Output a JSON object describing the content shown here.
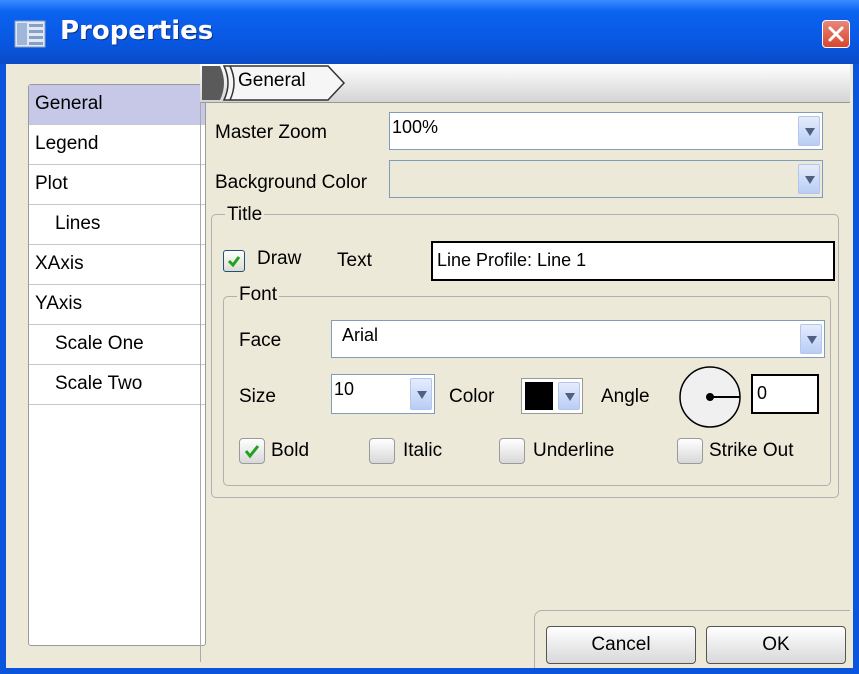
{
  "window": {
    "title": "Properties"
  },
  "sidebar": {
    "items": [
      {
        "label": "General",
        "selected": true
      },
      {
        "label": "Legend"
      },
      {
        "label": "Plot"
      },
      {
        "label": "Lines"
      },
      {
        "label": "XAxis"
      },
      {
        "label": "YAxis"
      },
      {
        "label": "Scale One"
      },
      {
        "label": "Scale Two"
      }
    ]
  },
  "tab": {
    "label": "General"
  },
  "general": {
    "master_zoom_label": "Master Zoom",
    "master_zoom_value": "100%",
    "background_color_label": "Background Color",
    "background_color_value": ""
  },
  "title_group": {
    "label": "Title",
    "draw_label": "Draw",
    "draw_checked": true,
    "text_label": "Text",
    "text_value": "Line Profile: Line 1"
  },
  "font_group": {
    "label": "Font",
    "face_label": "Face",
    "face_value": "Arial",
    "size_label": "Size",
    "size_value": "10",
    "color_label": "Color",
    "color_value": "#000000",
    "angle_label": "Angle",
    "angle_value": "0",
    "bold_label": "Bold",
    "bold_checked": true,
    "italic_label": "Italic",
    "underline_label": "Underline",
    "strikeout_label": "Strike Out"
  },
  "buttons": {
    "cancel_label": "Cancel",
    "ok_label": "OK"
  },
  "colors": {
    "title_bar": "#0856e0",
    "selected_item": "#c7c8e8",
    "dialog_bg": "#ece9d8"
  }
}
